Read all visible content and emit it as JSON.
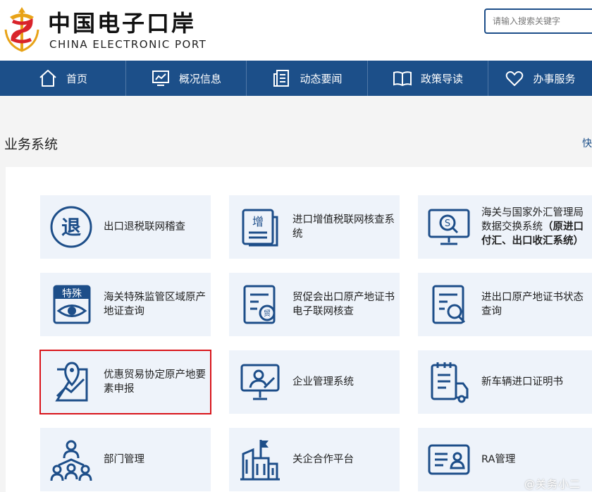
{
  "header": {
    "logo_cn": "中国电子口岸",
    "logo_en": "CHINA ELECTRONIC PORT",
    "search_placeholder": "请输入搜索关键字"
  },
  "nav": {
    "items": [
      {
        "label": "首页",
        "icon": "home-icon"
      },
      {
        "label": "概况信息",
        "icon": "chart-icon"
      },
      {
        "label": "动态要闻",
        "icon": "news-icon"
      },
      {
        "label": "政策导读",
        "icon": "book-icon"
      },
      {
        "label": "办事服务",
        "icon": "heart-icon"
      }
    ]
  },
  "section": {
    "title": "业务系统",
    "more": "快"
  },
  "cards": [
    {
      "label": "出口退税联网稽查",
      "icon": "tui-badge-icon",
      "selected": false
    },
    {
      "label": "进口增值税联网核查系统",
      "icon": "zeng-document-icon",
      "selected": false
    },
    {
      "label": "海关与国家外汇管理局数据交换系统",
      "label_bold": "（原进口付汇、出口收汇系统）",
      "icon": "monitor-search-icon",
      "selected": false
    },
    {
      "label": "海关特殊监管区域原产地证查询",
      "icon": "special-eye-icon",
      "selected": false
    },
    {
      "label": "贸促会出口原产地证书电子联网核查",
      "icon": "certificate-trade-icon",
      "selected": false
    },
    {
      "label": "进出口原产地证书状态查询",
      "icon": "certificate-search-icon",
      "selected": false
    },
    {
      "label": "优惠贸易协定原产地要素申报",
      "icon": "map-pin-chart-icon",
      "selected": true
    },
    {
      "label": "企业管理系统",
      "icon": "presentation-user-icon",
      "selected": false
    },
    {
      "label": "新车辆进口证明书",
      "icon": "clipboard-truck-icon",
      "selected": false
    },
    {
      "label": "部门管理",
      "icon": "org-chart-icon",
      "selected": false
    },
    {
      "label": "关企合作平台",
      "icon": "building-flag-icon",
      "selected": false
    },
    {
      "label": "RA管理",
      "icon": "id-card-icon",
      "selected": false
    }
  ],
  "watermark": "@关务小二",
  "colors": {
    "nav_bg": "#1c4f89",
    "icon_blue": "#1d4e89",
    "card_bg": "#eef3fa",
    "selected_border": "#d9151b",
    "logo_red": "#d9232a",
    "logo_gold": "#e8a317"
  }
}
